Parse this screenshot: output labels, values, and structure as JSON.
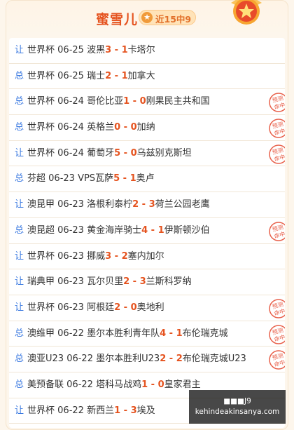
{
  "header": {
    "title": "蜜雪儿",
    "record": "近15中9"
  },
  "rows": [
    {
      "type": "让",
      "league": "世界杯",
      "date": "06-25",
      "home": "波黑",
      "hs": "3",
      "as": "1",
      "away": "卡塔尔",
      "hit": false
    },
    {
      "type": "总",
      "league": "世界杯",
      "date": "06-25",
      "home": "瑞士",
      "hs": "2",
      "as": "1",
      "away": "加拿大",
      "hit": false
    },
    {
      "type": "总",
      "league": "世界杯",
      "date": "06-24",
      "home": "哥伦比亚",
      "hs": "1",
      "as": "0",
      "away": "刚果民主共和国",
      "hit": true
    },
    {
      "type": "总",
      "league": "世界杯",
      "date": "06-24",
      "home": "英格兰",
      "hs": "0",
      "as": "0",
      "away": "加纳",
      "hit": true
    },
    {
      "type": "让",
      "league": "世界杯",
      "date": "06-24",
      "home": "葡萄牙",
      "hs": "5",
      "as": "0",
      "away": "乌兹别克斯坦",
      "hit": true
    },
    {
      "type": "总",
      "league": "芬超",
      "date": "06-23",
      "home": "VPS瓦萨",
      "hs": "5",
      "as": "1",
      "away": "奥卢",
      "hit": false
    },
    {
      "type": "让",
      "league": "澳昆甲",
      "date": "06-23",
      "home": "洛根利泰柠",
      "hs": "2",
      "as": "3",
      "away": "荷兰公园老鹰",
      "hit": false
    },
    {
      "type": "总",
      "league": "澳昆超",
      "date": "06-23",
      "home": "黄金海岸骑士",
      "hs": "4",
      "as": "1",
      "away": "伊斯顿沙伯",
      "hit": true
    },
    {
      "type": "让",
      "league": "世界杯",
      "date": "06-23",
      "home": "挪威",
      "hs": "3",
      "as": "2",
      "away": "塞内加尔",
      "hit": false
    },
    {
      "type": "让",
      "league": "瑞典甲",
      "date": "06-23",
      "home": "瓦尔贝里",
      "hs": "2",
      "as": "3",
      "away": "兰斯科罗纳",
      "hit": false
    },
    {
      "type": "让",
      "league": "世界杯",
      "date": "06-23",
      "home": "阿根廷",
      "hs": "2",
      "as": "0",
      "away": "奥地利",
      "hit": true
    },
    {
      "type": "总",
      "league": "澳维甲",
      "date": "06-22",
      "home": "墨尔本胜利青年队",
      "hs": "4",
      "as": "1",
      "away": "布伦瑞克城",
      "hit": true
    },
    {
      "type": "总",
      "league": "澳亚U23",
      "date": "06-22",
      "home": "墨尔本胜利U23",
      "hs": "2",
      "as": "2",
      "away": "布伦瑞克城U23",
      "hit": true
    },
    {
      "type": "总",
      "league": "美预备联",
      "date": "06-22",
      "home": "塔科马战鸡",
      "hs": "1",
      "as": "0",
      "away": "皇家君主",
      "hit": false
    },
    {
      "type": "让",
      "league": "世界杯",
      "date": "06-22",
      "home": "新西兰",
      "hs": "1",
      "as": "3",
      "away": "埃及",
      "hit": false
    }
  ],
  "stamp_text": [
    "预测",
    "命中"
  ],
  "watermark": {
    "line1": "■■■J9",
    "line2": "kehindeakinsanya.com"
  },
  "colors": {
    "accent": "#e5531f",
    "type": "#3978e0",
    "stamp": "#e8604a"
  }
}
